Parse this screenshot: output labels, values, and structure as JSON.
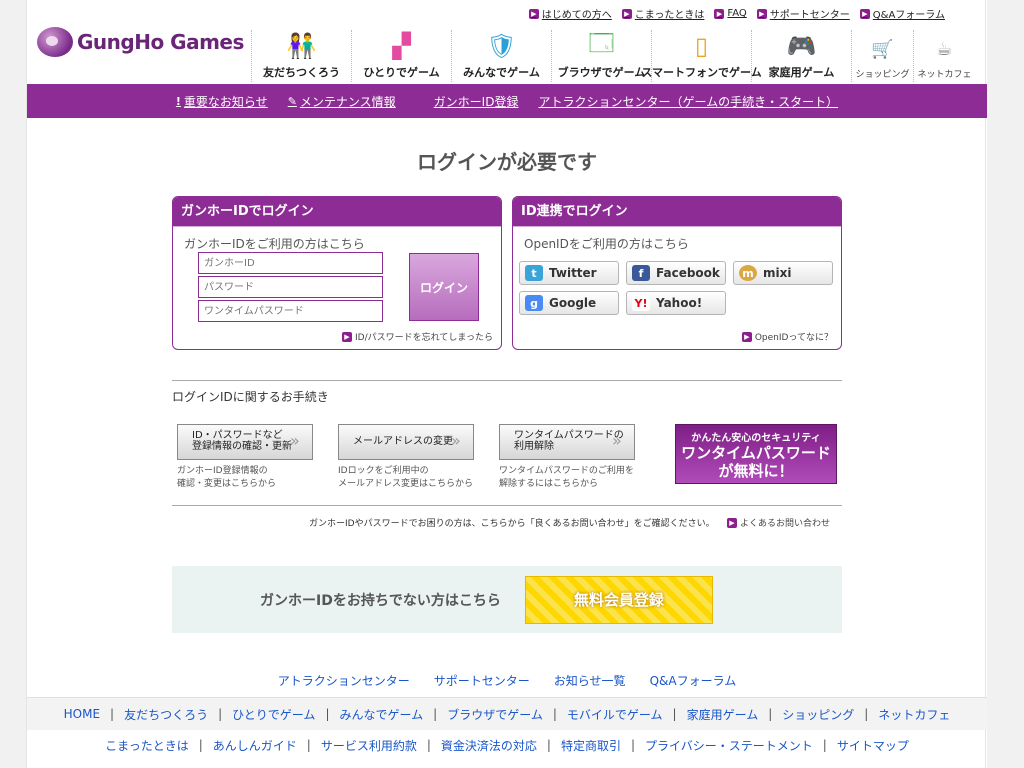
{
  "utility_nav": [
    "はじめての方へ",
    "こまったときは",
    "FAQ",
    "サポートセンター",
    "Q&Aフォーラム"
  ],
  "logo": "GungHo Games",
  "global_nav": [
    {
      "label": "友だちつくろう",
      "icon": "friends-icon"
    },
    {
      "label": "ひとりでゲーム",
      "icon": "blocks-icon"
    },
    {
      "label": "みんなでゲーム",
      "icon": "sword-shield-icon"
    },
    {
      "label": "ブラウザでゲーム",
      "icon": "browser-icon"
    },
    {
      "label": "スマートフォンでゲーム",
      "icon": "smartphone-icon"
    },
    {
      "label": "家庭用ゲーム",
      "icon": "gamepad-icon"
    },
    {
      "label": "ショッピング",
      "icon": "cart-icon"
    },
    {
      "label": "ネットカフェ",
      "icon": "coffee-icon"
    }
  ],
  "purple_bar": [
    "重要なお知らせ",
    "メンテナンス情報",
    "ガンホーID登録",
    "アトラクションセンター（ゲームの手続き・スタート）"
  ],
  "page_title": "ログインが必要です",
  "id_login": {
    "header": "ガンホーIDでログイン",
    "sub": "ガンホーIDをご利用の方はこちら",
    "id_placeholder": "ガンホーID",
    "password_placeholder": "パスワード",
    "onetime_placeholder": "ワンタイムパスワード",
    "login_button": "ログイン",
    "forgot_link": "ID/パスワードを忘れてしまったら"
  },
  "openid_login": {
    "header": "ID連携でログイン",
    "sub": "OpenIDをご利用の方はこちら",
    "services": [
      {
        "label": "Twitter",
        "color": "#3aa4d9",
        "glyph": "t"
      },
      {
        "label": "Facebook",
        "color": "#3b5998",
        "glyph": "f"
      },
      {
        "label": "mixi",
        "color": "#d9a845",
        "glyph": "m"
      },
      {
        "label": "Google",
        "color": "#4a8af4",
        "glyph": "g"
      },
      {
        "label": "Yahoo!",
        "color": "#e60012",
        "glyph": "Y!"
      }
    ],
    "what_link": "OpenIDってなに？"
  },
  "procedures": {
    "title": "ログインIDに関するお手続き",
    "items": [
      {
        "button": "ID・パスワードなど\n登録情報の確認・更新",
        "desc": "ガンホーID登録情報の\n確認・変更はこちらから"
      },
      {
        "button": "メールアドレスの変更",
        "desc": "IDロックをご利用中の\nメールアドレス変更はこちらから"
      },
      {
        "button": "ワンタイムパスワードの\n利用解除",
        "desc": "ワンタイムパスワードのご利用を\n解除するにはこちらから"
      }
    ],
    "promo_line1": "かんたん安心のセキュリティ",
    "promo_line2": "ワンタイムパスワード",
    "promo_line3": "が無料に！"
  },
  "help_text": "ガンホーIDやパスワードでお困りの方は、こちらから「良くあるお問い合わせ」をご確認ください。",
  "help_link": "よくあるお問い合わせ",
  "register": {
    "text": "ガンホーIDをお持ちでない方はこちら",
    "button": "無料会員登録"
  },
  "footer_links_1": [
    "アトラクションセンター",
    "サポートセンター",
    "お知らせ一覧",
    "Q&Aフォーラム"
  ],
  "footer_links_2": [
    "HOME",
    "友だちつくろう",
    "ひとりでゲーム",
    "みんなでゲーム",
    "ブラウザでゲーム",
    "モバイルでゲーム",
    "家庭用ゲーム",
    "ショッピング",
    "ネットカフェ"
  ],
  "footer_links_3": [
    "こまったときは",
    "あんしんガイド",
    "サービス利用約款",
    "資金決済法の対応",
    "特定商取引",
    "プライバシー・ステートメント",
    "サイトマップ"
  ]
}
